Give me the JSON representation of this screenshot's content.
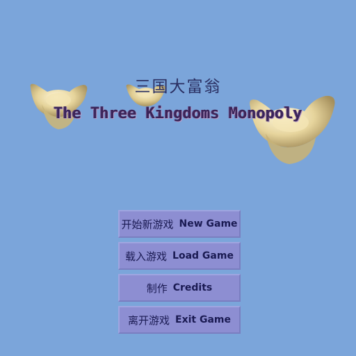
{
  "game": {
    "title_cn": "三国大富翁",
    "title_en": "The Three Kingdoms Monopoly"
  },
  "menu": {
    "items": [
      {
        "cn": "开始新游戏",
        "en": "New Game"
      },
      {
        "cn": "载入游戏",
        "en": "Load Game"
      },
      {
        "cn": "制作",
        "en": "Credits"
      },
      {
        "cn": "离开游戏",
        "en": "Exit Game"
      }
    ]
  },
  "colors": {
    "background": "#7ba5da",
    "button": "#8d8ed2",
    "button_text": "#1a1a52",
    "title_en": "#3a2458"
  }
}
